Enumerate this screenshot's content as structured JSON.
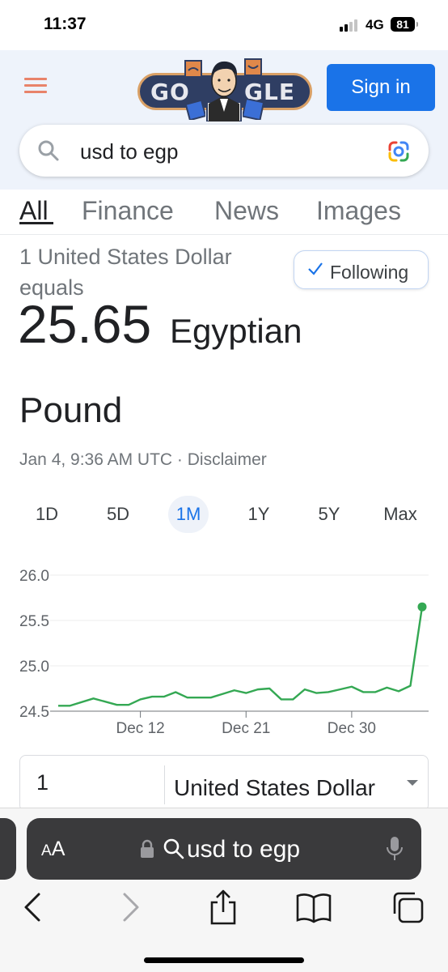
{
  "status_bar": {
    "time": "11:37",
    "network": "4G",
    "battery": "81"
  },
  "header": {
    "doodle_text_left": "GO",
    "doodle_text_right": "GLE",
    "sign_in_label": "Sign in"
  },
  "search": {
    "query": "usd to egp"
  },
  "tabs": [
    {
      "label": "All",
      "active": true
    },
    {
      "label": "Finance",
      "active": false
    },
    {
      "label": "News",
      "active": false
    },
    {
      "label": "Images",
      "active": false
    }
  ],
  "result": {
    "equals_line": "1 United States Dollar equals",
    "value": "25.65",
    "unit_line1": "Egyptian",
    "unit_line2": "Pound",
    "following_label": "Following",
    "timestamp": "Jan 4, 9:36 AM UTC · Disclaimer"
  },
  "ranges": [
    {
      "label": "1D",
      "active": false
    },
    {
      "label": "5D",
      "active": false
    },
    {
      "label": "1M",
      "active": true
    },
    {
      "label": "1Y",
      "active": false
    },
    {
      "label": "5Y",
      "active": false
    },
    {
      "label": "Max",
      "active": false
    }
  ],
  "chart_data": {
    "type": "line",
    "title": "",
    "xlabel": "",
    "ylabel": "",
    "ylim": [
      24.5,
      26.0
    ],
    "yticks": [
      "26.0",
      "25.5",
      "25.0",
      "24.5"
    ],
    "xtick_labels": [
      "Dec 12",
      "Dec 21",
      "Dec 30"
    ],
    "xtick_days": [
      7,
      16,
      25
    ],
    "x_days": [
      0,
      1,
      3,
      5,
      6,
      7,
      8,
      9,
      10,
      11,
      12,
      13,
      14,
      15,
      16,
      17,
      18,
      19,
      20,
      21,
      22,
      23,
      24,
      25,
      26,
      27,
      28,
      29,
      30
    ],
    "values": [
      24.56,
      24.56,
      24.64,
      24.57,
      24.57,
      24.63,
      24.66,
      24.66,
      24.71,
      24.65,
      24.65,
      24.65,
      24.69,
      24.73,
      24.7,
      24.74,
      24.75,
      24.63,
      24.63,
      24.74,
      24.7,
      24.71,
      24.74,
      24.77,
      24.71,
      24.71,
      24.76,
      24.72,
      24.78
    ],
    "last_point": {
      "x_day": 31,
      "value": 25.65
    },
    "line_color": "#34a853",
    "grid": true
  },
  "converter": {
    "amount": "1",
    "currency": "United States Dollar"
  },
  "safari": {
    "aa_small": "A",
    "aa_large": "A",
    "address_text": "usd to egp"
  }
}
